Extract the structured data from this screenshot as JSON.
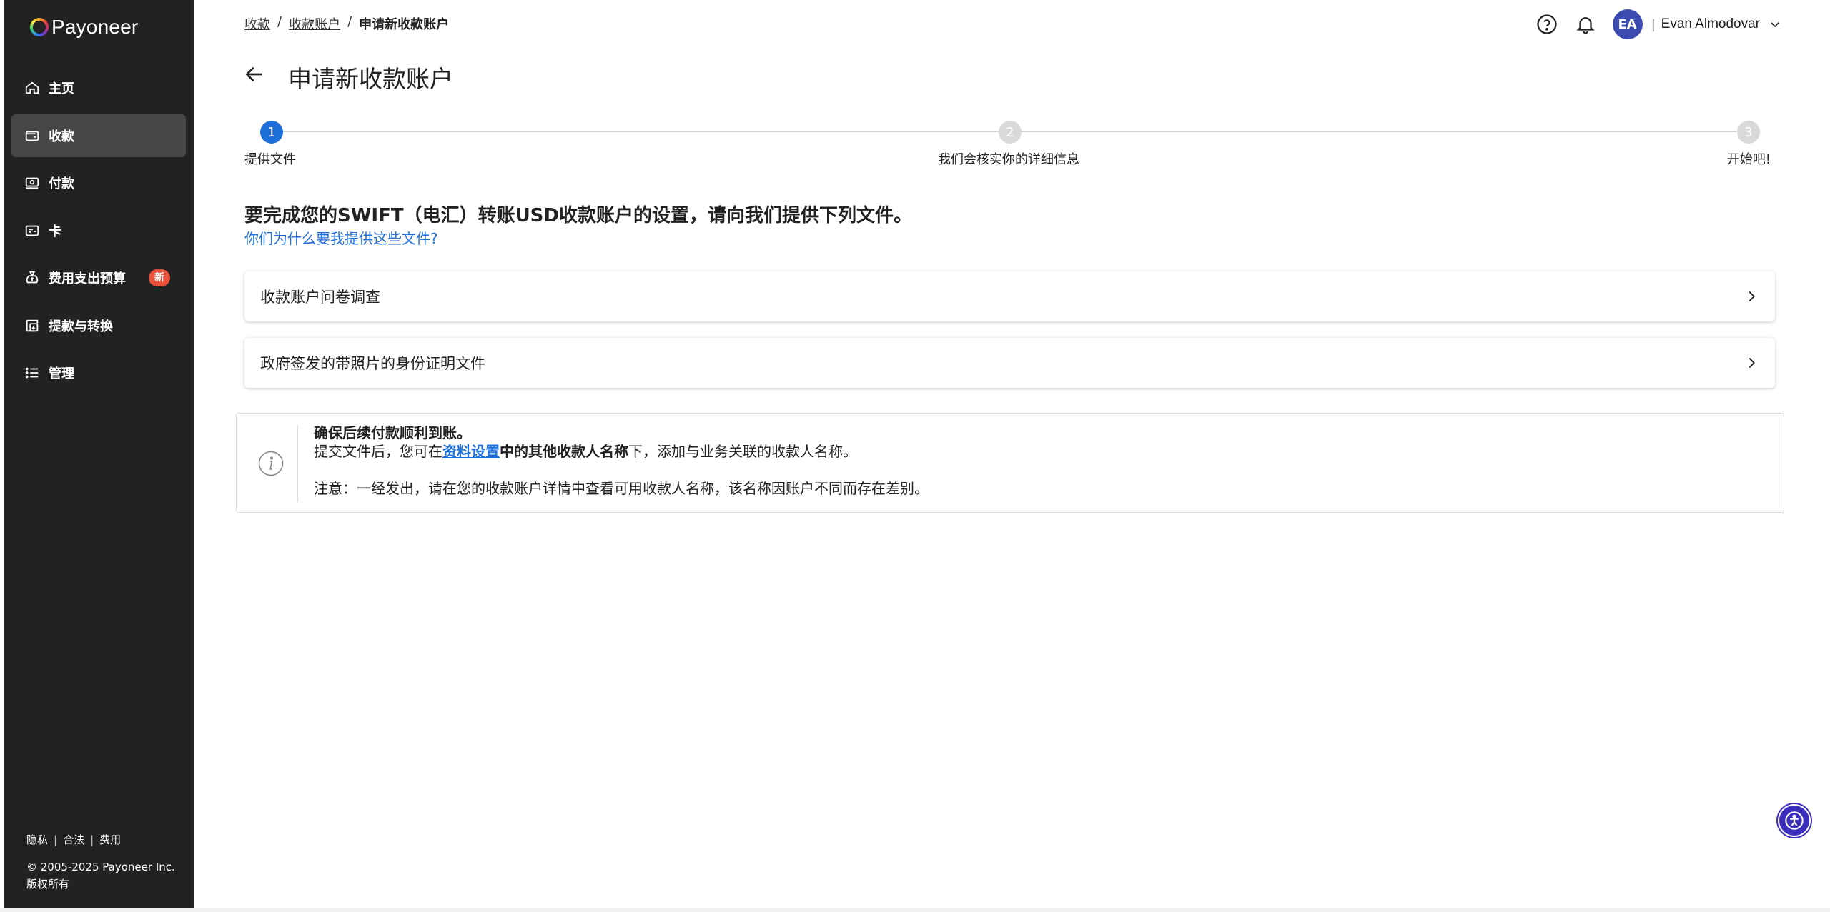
{
  "brand": {
    "name": "Payoneer"
  },
  "sidebar": {
    "items": [
      {
        "label": "主页",
        "icon": "home-icon"
      },
      {
        "label": "收款",
        "icon": "wallet-icon"
      },
      {
        "label": "付款",
        "icon": "cash-icon"
      },
      {
        "label": "卡",
        "icon": "card-icon"
      },
      {
        "label": "费用支出预算",
        "icon": "money-bag-icon",
        "badge": "新"
      },
      {
        "label": "提款与转换",
        "icon": "withdraw-icon"
      },
      {
        "label": "管理",
        "icon": "list-icon"
      }
    ],
    "active_item": "收款",
    "footer": {
      "privacy": "隐私",
      "legal": "合法",
      "fees": "费用",
      "copyright": "© 2005-2025 Payoneer Inc.",
      "rights": "版权所有"
    }
  },
  "breadcrumb": {
    "items": [
      "收款",
      "收款账户"
    ],
    "separator": "/",
    "current": "申请新收款账户"
  },
  "header": {
    "avatar_initials": "EA",
    "separator": "|",
    "user_name": "Evan Almodovar"
  },
  "page": {
    "title": "申请新收款账户"
  },
  "stepper": {
    "steps": [
      {
        "number": "1",
        "label": "提供文件"
      },
      {
        "number": "2",
        "label": "我们会核实你的详细信息"
      },
      {
        "number": "3",
        "label": "开始吧!"
      }
    ],
    "active_step": 1
  },
  "content": {
    "heading": "要完成您的SWIFT（电汇）转账USD收款账户的设置，请向我们提供下列文件。",
    "why_link": "你们为什么要我提供这些文件?",
    "documents": [
      {
        "label": "收款账户问卷调查"
      },
      {
        "label": "政府签发的带照片的身份证明文件"
      }
    ]
  },
  "info": {
    "title": "确保后续付款顺利到账。",
    "line2_pre": "提交文件后，您可在",
    "line2_link": "资料设置",
    "line2_mid": "中的",
    "line2_bold": "其他收款人名称",
    "line2_post": "下，添加与业务关联的收款人名称。",
    "note": "注意：一经发出，请在您的收款账户详情中查看可用收款人名称，该名称因账户不同而存在差别。"
  },
  "colors": {
    "sidebar_bg": "#222222",
    "accent": "#1f6fdb",
    "badge": "#e8503a",
    "avatar": "#3b4bb0",
    "a11y_button": "#3b2dbd"
  }
}
